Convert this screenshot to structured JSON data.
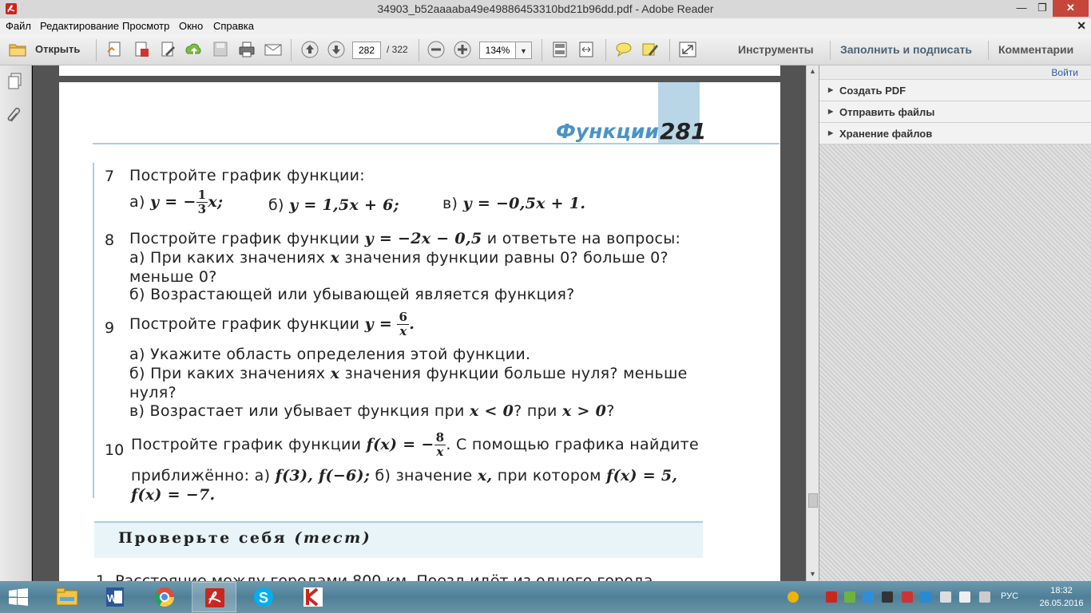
{
  "window": {
    "title": "34903_b52aaaaba49e49886453310bd21b96dd.pdf - Adobe Reader"
  },
  "menu": [
    "Файл",
    "Редактирование",
    "Просмотр",
    "Окно",
    "Справка"
  ],
  "toolbar": {
    "open_label": "Открыть",
    "page_current": "282",
    "page_total": "/ 322",
    "zoom": "134%",
    "tools": "Инструменты",
    "fill_sign": "Заполнить и подписать",
    "comments": "Комментарии"
  },
  "right_pane": {
    "login": "Войти",
    "items": [
      "Создать PDF",
      "Отправить файлы",
      "Хранение файлов"
    ]
  },
  "page": {
    "header_title": "Функции",
    "header_number": "281",
    "problems": [
      {
        "num": "7",
        "text": "Постройте график функции:",
        "a_label": "а)",
        "a_pre": "y = −",
        "a_frac_n": "1",
        "a_frac_d": "3",
        "a_post": "x;",
        "b_label": "б)",
        "b_eq": "y = 1,5x + 6;",
        "c_label": "в)",
        "c_eq": "y = −0,5x + 1."
      },
      {
        "num": "8",
        "text_pre": "Постройте график функции",
        "eq": "y = −2x − 0,5",
        "text_post": "и ответьте на вопросы:",
        "a_pre": "а) При каких значениях",
        "a_var": "x",
        "a_post": "значения функции равны 0? больше 0?",
        "a_cont": "меньше 0?",
        "b": "б)  Возрастающей или убывающей является функция?"
      },
      {
        "num": "9",
        "text_pre": "Постройте график функции",
        "eq_pre": "y =",
        "frac_n": "6",
        "frac_d": "x",
        "eq_post": ".",
        "a": "а) Укажите область определения этой функции.",
        "b_pre": "б) При каких значениях",
        "b_var": "x",
        "b_post": "значения функции больше нуля? меньше",
        "b_cont": "нуля?",
        "c_pre": "в) Возрастает или убывает функция при",
        "c_eq1": "x < 0",
        "c_mid": "? при",
        "c_eq2": "x > 0",
        "c_post": "?"
      },
      {
        "num": "10",
        "text_pre": "Постройте график функции",
        "eq_pre": "f(x) = −",
        "frac_n": "8",
        "frac_d": "x",
        "text_post": ". С помощью графика найдите",
        "line2_pre": "приближённо: а)",
        "line2_eq1": "f(3),  f(−6);",
        "line2_mid": "б) значение",
        "line2_var": "x,",
        "line2_mid2": "при котором",
        "line2_eq2": "f(x) = 5,",
        "line3": "f(x) = −7."
      }
    ],
    "test_title": "Проверьте себя",
    "test_sub": "(тест)",
    "next_line": "1. Расстояние между городами 800 км. Поезд идёт из одного города"
  },
  "taskbar": {
    "lang": "РУС",
    "time": "18:32",
    "date": "26.05.2016"
  }
}
